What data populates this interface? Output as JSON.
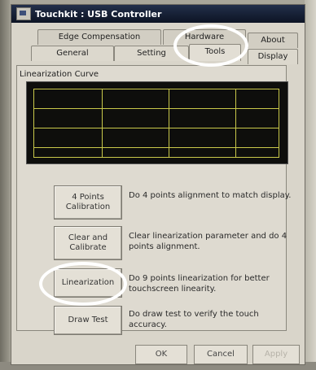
{
  "window": {
    "title": "Touchkit : USB Controller"
  },
  "tabs": {
    "back_row": [
      "Edge Compensation",
      "Hardware",
      "About"
    ],
    "front_row": [
      "General",
      "Setting",
      "Tools",
      "Display"
    ],
    "active": "Tools"
  },
  "linearization_section": {
    "label": "Linearization Curve"
  },
  "tools": [
    {
      "button": "4 Points Calibration",
      "description": "Do 4 points alignment to match display."
    },
    {
      "button": "Clear and Calibrate",
      "description": "Clear linearization parameter and do 4 points alignment."
    },
    {
      "button": "Linearization",
      "description": "Do 9 points linearization for better touchscreen linearity."
    },
    {
      "button": "Draw Test",
      "description": "Do draw test to verify the touch accuracy."
    }
  ],
  "dialog_buttons": {
    "ok": "OK",
    "cancel": "Cancel",
    "apply": "Apply"
  },
  "colors": {
    "titlebar": "#0d1424",
    "grid": "#c9c84a",
    "curve_bg": "#0e0e0c",
    "highlight": "#ffffff"
  }
}
